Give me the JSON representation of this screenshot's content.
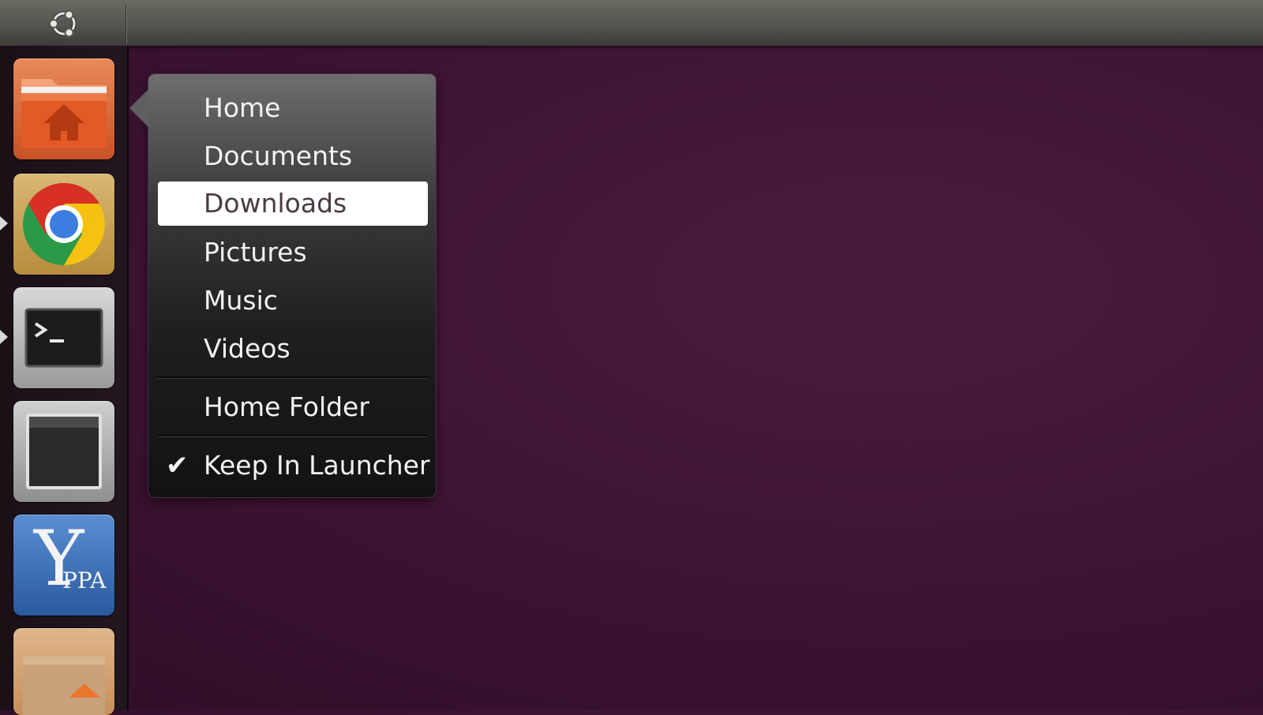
{
  "quicklist": {
    "items": [
      {
        "label": "Home"
      },
      {
        "label": "Documents"
      },
      {
        "label": "Downloads",
        "selected": true
      },
      {
        "label": "Pictures"
      },
      {
        "label": "Music"
      },
      {
        "label": "Videos"
      }
    ],
    "home_folder": "Home Folder",
    "keep_in_launcher": "Keep In Launcher",
    "keep_in_launcher_checked": true
  },
  "launcher": {
    "icons": [
      "home-folder-icon",
      "chrome-icon",
      "terminal-icon",
      "window-icon",
      "y-ppa-icon",
      "package-icon"
    ],
    "ppa_logo_text": "PPA",
    "ppa_logo_letter": "Y"
  },
  "colors": {
    "desktop": "#3f1434",
    "selection": "#ffffff",
    "folder_orange": "#e2602d"
  }
}
